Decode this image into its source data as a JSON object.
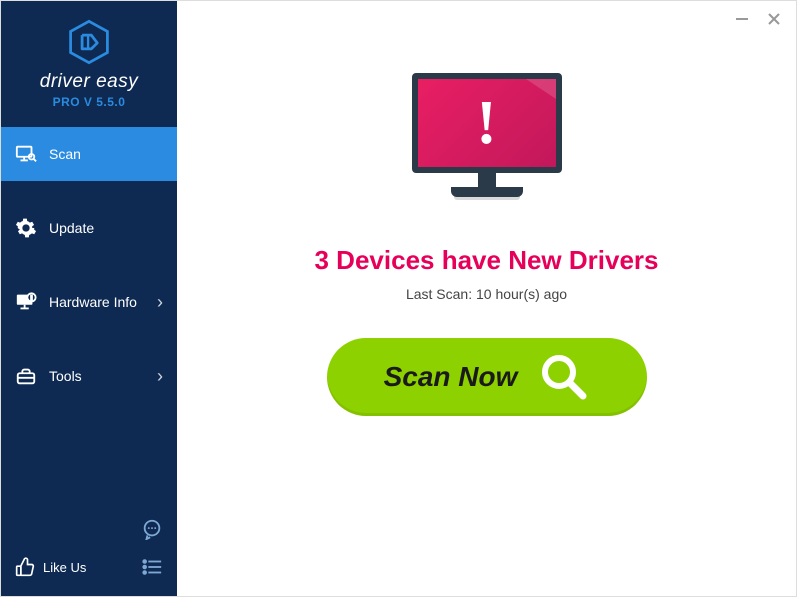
{
  "brand": "driver easy",
  "version": "PRO V 5.5.0",
  "nav": {
    "scan": "Scan",
    "update": "Update",
    "hardware": "Hardware Info",
    "tools": "Tools"
  },
  "likeus": "Like Us",
  "headline": "3 Devices have New Drivers",
  "subline": "Last Scan: 10 hour(s) ago",
  "scan_button": "Scan Now",
  "colors": {
    "accent": "#2a8be0",
    "sidebar": "#0e2a52",
    "alert": "#e6005a",
    "action": "#8ed100"
  }
}
